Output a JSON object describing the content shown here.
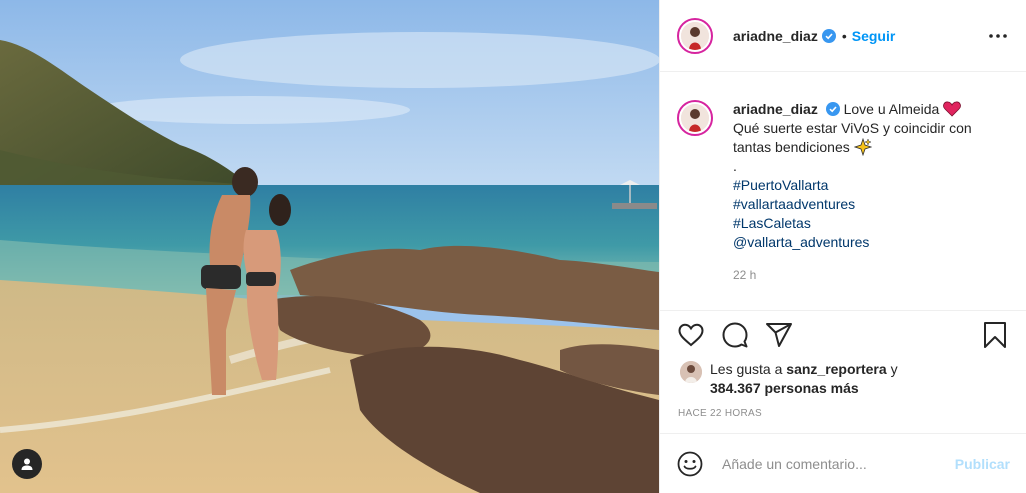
{
  "post": {
    "author": "ariadne_diaz",
    "follow_label": "Seguir",
    "dot": "•",
    "caption": {
      "line1": "Love u Almeida",
      "line2": "Qué suerte estar ViVoS y coincidir con",
      "line3": "tantas bendiciones",
      "line4": ".",
      "hashtags": [
        "#PuertoVallarta",
        "#vallartaadventures",
        "#LasCaletas",
        "@vallarta_adventures"
      ]
    },
    "caption_time": "22 h",
    "likes": {
      "prefix": "Les gusta a",
      "user": "sanz_reportera",
      "mid": "y",
      "count": "384.367",
      "suffix": "personas más"
    },
    "posted_ago": "HACE 22 HORAS",
    "composer": {
      "placeholder": "Añade un comentario...",
      "publish_label": "Publicar"
    }
  },
  "icons": {
    "verified": "verified-badge-icon",
    "more": "more-options-icon",
    "like": "heart-outline-icon",
    "comment": "comment-bubble-icon",
    "share": "paper-plane-icon",
    "save": "bookmark-icon",
    "emoji": "emoji-smiley-icon",
    "tag": "user-tag-icon"
  },
  "colors": {
    "verified": "#3897f0",
    "follow": "#0095f6",
    "publish_disabled": "#b2dffc",
    "hashtag": "#00376b",
    "heart_emoji": "#e0245e"
  }
}
